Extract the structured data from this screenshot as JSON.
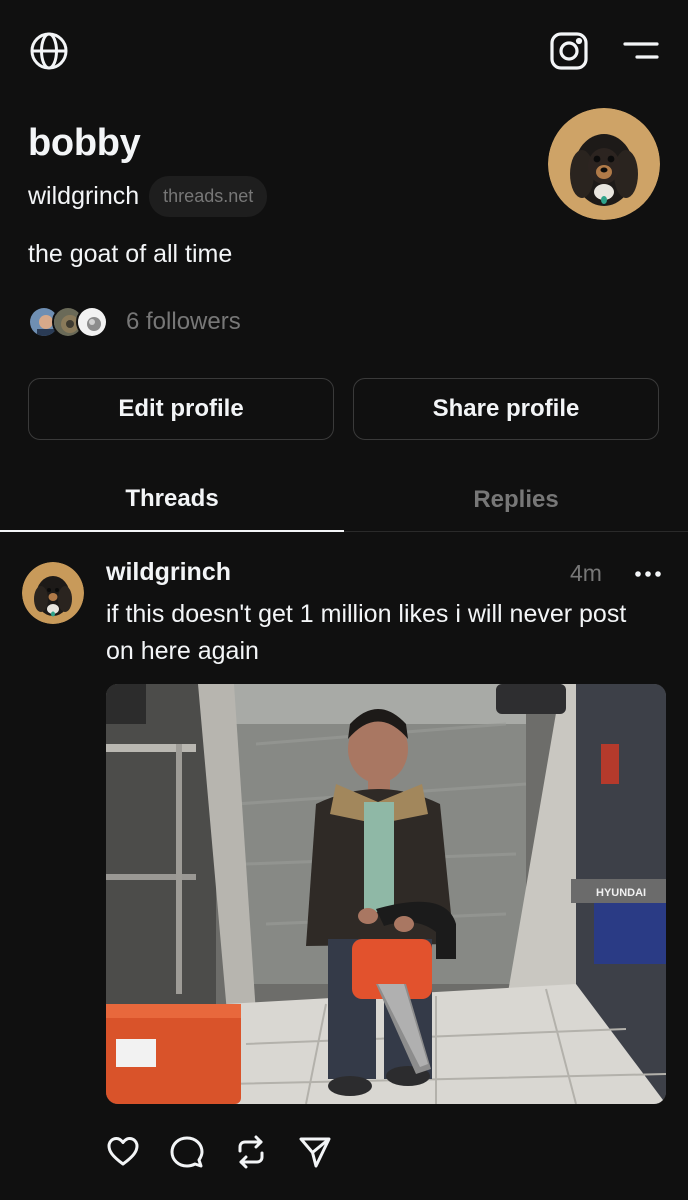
{
  "profile": {
    "name": "bobby",
    "handle": "wildgrinch",
    "domain": "threads.net",
    "bio": "the goat of all time",
    "followers_text": "6 followers"
  },
  "buttons": {
    "edit": "Edit profile",
    "share": "Share profile"
  },
  "tabs": [
    {
      "label": "Threads",
      "active": true
    },
    {
      "label": "Replies",
      "active": false
    }
  ],
  "post": {
    "user": "wildgrinch",
    "time": "4m",
    "text": "if this doesn't get 1 million likes i will never post on here again",
    "image_sign_text": "HYUNDAI"
  },
  "icons": {
    "top_left": "globe-icon",
    "top_right_1": "instagram-icon",
    "top_right_2": "menu-icon",
    "actions": [
      "heart-icon",
      "comment-icon",
      "repost-icon",
      "share-icon"
    ]
  },
  "colors": {
    "background": "#101010",
    "text": "#f3f5f7",
    "muted": "#777777",
    "border": "#3a3a3a"
  }
}
